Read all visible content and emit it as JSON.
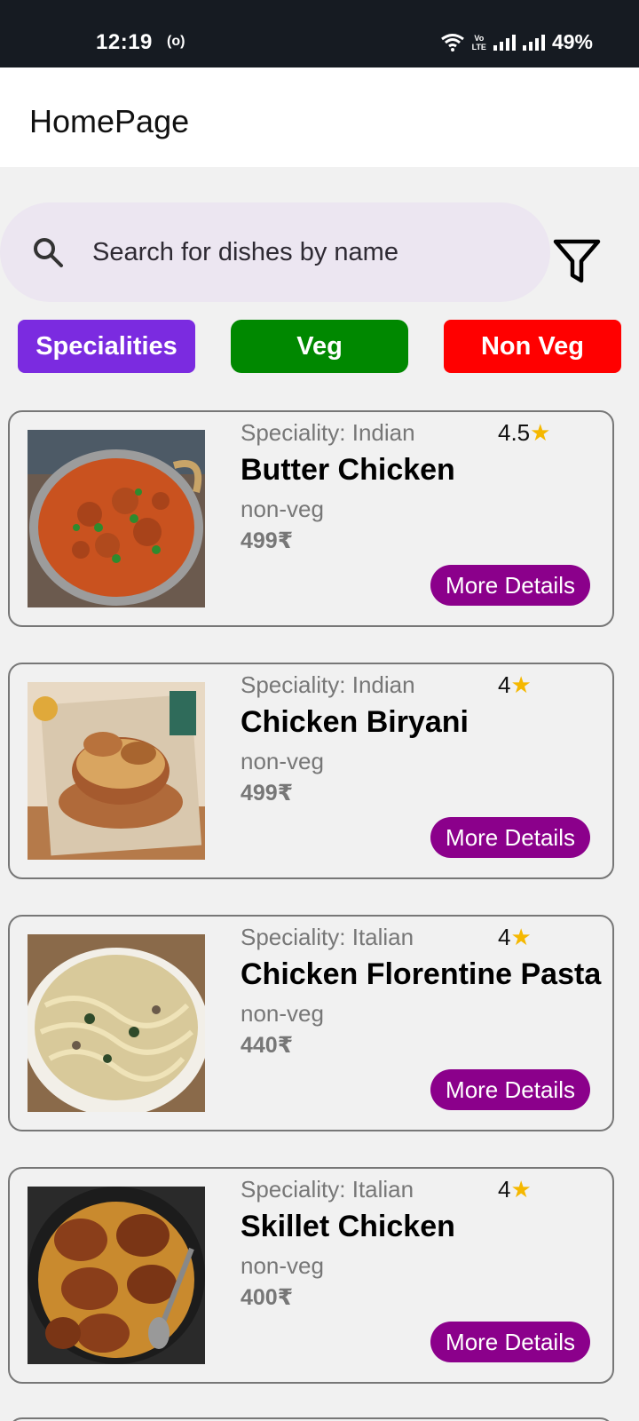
{
  "status": {
    "time": "12:19",
    "radio": "(o)",
    "volte_top": "Vo",
    "volte_bottom": "LTE",
    "battery": "49%"
  },
  "appbar": {
    "title": "HomePage"
  },
  "search": {
    "placeholder": "Search for dishes by name"
  },
  "filters": {
    "specialities": "Specialities",
    "veg": "Veg",
    "non_veg": "Non Veg"
  },
  "colors": {
    "specialities": "#7b2be0",
    "veg": "#008800",
    "non_veg": "#ff0000",
    "more_details": "#8b008b"
  },
  "dishes": [
    {
      "speciality": "Speciality: Indian",
      "rating": "4.5",
      "name": "Butter Chicken",
      "type": "non-veg",
      "price": "499₹",
      "button": "More Details"
    },
    {
      "speciality": "Speciality: Indian",
      "rating": "4",
      "name": "Chicken Biryani",
      "type": "non-veg",
      "price": "499₹",
      "button": "More Details"
    },
    {
      "speciality": "Speciality: Italian",
      "rating": "4",
      "name": "Chicken Florentine Pasta",
      "type": "non-veg",
      "price": "440₹",
      "button": "More Details"
    },
    {
      "speciality": "Speciality: Italian",
      "rating": "4",
      "name": "Skillet Chicken",
      "type": "non-veg",
      "price": "400₹",
      "button": "More Details"
    }
  ]
}
